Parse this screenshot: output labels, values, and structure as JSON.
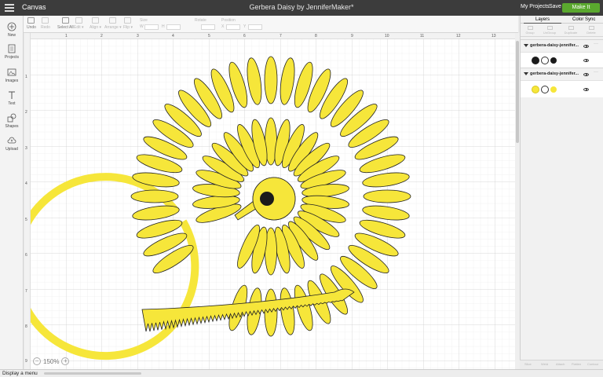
{
  "topbar": {
    "app_title": "Canvas",
    "document_title": "Gerbera Daisy by JenniferMaker*",
    "my_projects": "My Projects",
    "save": "Save",
    "make_it": "Make It",
    "make_it_color": "#5aa82e"
  },
  "toolbar": {
    "undo": "Undo",
    "redo": "Redo",
    "select_all": "Select All",
    "edit": "Edit ▾",
    "align": "Align ▾",
    "arrange": "Arrange ▾",
    "flip": "Flip ▾",
    "size": "Size",
    "w": "W",
    "h": "H",
    "rotate": "Rotate",
    "position": "Position",
    "x": "X",
    "y": "Y"
  },
  "sidebar": {
    "items": [
      {
        "label": "New",
        "icon": "plus-icon"
      },
      {
        "label": "Projects",
        "icon": "projects-icon"
      },
      {
        "label": "Images",
        "icon": "images-icon"
      },
      {
        "label": "Text",
        "icon": "text-icon"
      },
      {
        "label": "Shapes",
        "icon": "shapes-icon"
      },
      {
        "label": "Upload",
        "icon": "upload-icon"
      }
    ]
  },
  "ruler": {
    "top": [
      "1",
      "2",
      "3",
      "4",
      "5",
      "6",
      "7",
      "8",
      "9",
      "10",
      "11",
      "12",
      "13"
    ],
    "left": [
      "1",
      "2",
      "3",
      "4",
      "5",
      "6",
      "7",
      "8",
      "9"
    ]
  },
  "zoom": {
    "minus": "−",
    "value": "150%",
    "plus": "+"
  },
  "layers_panel": {
    "tabs": [
      "Layers",
      "Color Sync"
    ],
    "actions": [
      "Group",
      "UnGroup",
      "Duplicate",
      "Delete"
    ],
    "groups": [
      {
        "name": "gerbera-daisy-jennifer...",
        "swatch_colors": [
          "#1b1b1b",
          "#1b1b1b"
        ]
      },
      {
        "name": "gerbera-daisy-jennifer...",
        "swatch_colors": [
          "#f6e63a",
          "#f6e63a"
        ]
      }
    ],
    "bottom_actions": [
      "Slice",
      "Weld",
      "Attach",
      "Flatten",
      "Contour"
    ]
  },
  "artwork": {
    "petal_color": "#f6e63a",
    "outline_color": "#222222",
    "center_color": "#1b1b1b"
  },
  "statusbar": {
    "text": "Display a menu"
  }
}
